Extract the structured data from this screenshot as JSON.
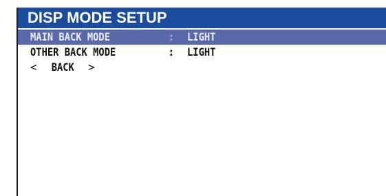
{
  "window": {
    "title": "DISP MODE SETUP"
  },
  "menu": {
    "items": [
      {
        "label": "MAIN BACK MODE",
        "separator": ":",
        "value": "LIGHT",
        "selected": true
      },
      {
        "label": "OTHER BACK MODE",
        "separator": ":",
        "value": "LIGHT",
        "selected": false
      }
    ],
    "back": {
      "left_arrow": "<",
      "label": "BACK",
      "right_arrow": ">"
    }
  },
  "colors": {
    "title_bar": "#1b4b9c",
    "title_text": "#ffffff",
    "selected_row": "#5868a8",
    "selected_text": "#e8ecf8",
    "text": "#111111"
  }
}
